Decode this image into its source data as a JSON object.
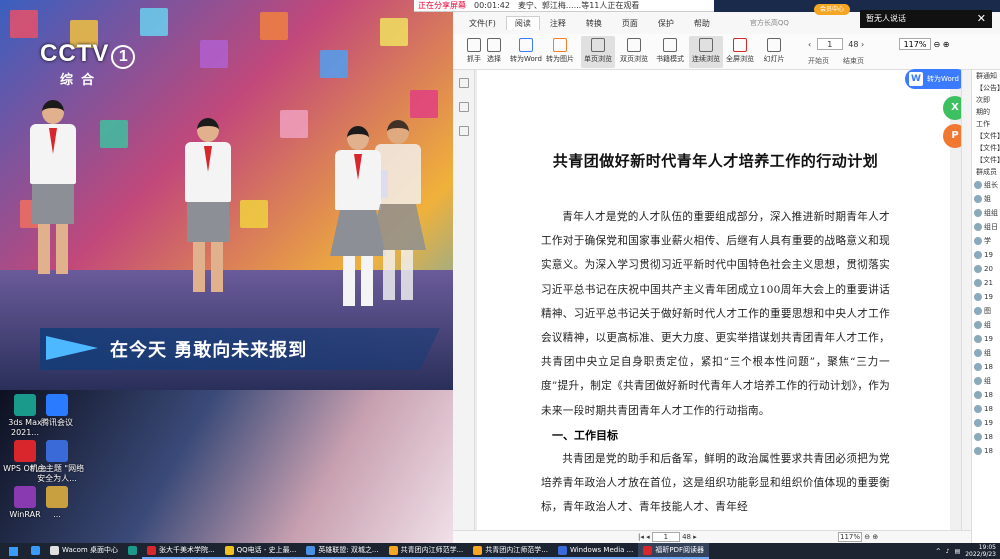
{
  "video": {
    "channel": "CCTV",
    "channel_num": "1",
    "channel_sub": "综合",
    "caption": "在今天 勇敢向未来报到"
  },
  "desktop_icons": [
    {
      "label": "3ds Max 2021...",
      "color": "#1a9a8a"
    },
    {
      "label": "腾讯会议",
      "color": "#2a7bff"
    },
    {
      "label": "WPS Office",
      "color": "#d8262c"
    },
    {
      "label": "机主主题 \"网络安全为人...",
      "color": "#3a6ad8"
    },
    {
      "label": "WinRAR",
      "color": "#8a3ab0"
    },
    {
      "label": "...",
      "color": "#c8a040"
    }
  ],
  "sharebar": {
    "status": "正在分享屏幕",
    "timer": "00:01:42",
    "viewers": "麦宁、郭江梅......等11人正在观看"
  },
  "app": {
    "menu": [
      "文件(F)",
      "阅读",
      "注释",
      "转换",
      "页面",
      "保护",
      "帮助"
    ],
    "menu_active": "阅读",
    "brand": "官方长高QQ",
    "member": "会员中心",
    "notice": "暂无人说话",
    "toolbar": [
      {
        "label": "抓手",
        "selected": false
      },
      {
        "label": "选择",
        "selected": false
      },
      {
        "label": "转为Word",
        "selected": false
      },
      {
        "label": "转为图片",
        "selected": false
      },
      {
        "label": "单页浏览",
        "selected": true
      },
      {
        "label": "双页浏览",
        "selected": false
      },
      {
        "label": "书籍模式",
        "selected": false
      },
      {
        "label": "连续浏览",
        "selected": true
      },
      {
        "label": "全屏浏览",
        "selected": false
      },
      {
        "label": "幻灯片",
        "selected": false
      }
    ],
    "page_current": "1",
    "page_total": "48",
    "zoom": "117%",
    "nav_start": "开始页",
    "nav_end": "结束页",
    "to_word_btn": "转为Word",
    "float_x": "X",
    "float_p": "P"
  },
  "document": {
    "title": "共青团做好新时代青年人才培养工作的行动计划",
    "paragraph1": "青年人才是党的人才队伍的重要组成部分，深入推进新时期青年人才工作对于确保党和国家事业薪火相传、后继有人具有重要的战略意义和现实意义。为深入学习贯彻习近平新时代中国特色社会主义思想，贯彻落实习近平总书记在庆祝中国共产主义青年团成立100周年大会上的重要讲话精神、习近平总书记关于做好新时代人才工作的重要思想和中央人才工作会议精神，以更高标准、更大力度、更实举措谋划共青团青年人才工作，共青团中央立足自身职责定位，紧扣“三个根本性问题”，聚焦“三力一度”提升，制定《共青团做好新时代青年人才培养工作的行动计划》，作为未来一段时期共青团青年人才工作的行动指南。",
    "heading1": "一、工作目标",
    "paragraph2": "共青团是党的助手和后备军，鲜明的政治属性要求共青团必须把为党培养青年政治人才放在首位，这是组织功能彰显和组织价值体现的重要衡标，青年政治人才、青年技能人才、青年经"
  },
  "statusbar": {
    "page_current": "1",
    "page_total": "48",
    "zoom": "117%"
  },
  "qq_panel": {
    "lines": [
      "群通知",
      "【公告】",
      "次即",
      "期的",
      "工作",
      "【文件】",
      "【文件】",
      "【文件】",
      "群成员"
    ],
    "members": [
      "组长",
      "姐",
      "组组",
      "组日",
      "学",
      "19",
      "20",
      "21",
      "19",
      "图",
      "组",
      "19",
      "组",
      "18",
      "组",
      "18",
      "18",
      "19",
      "18",
      "18"
    ]
  },
  "taskbar": {
    "apps": [
      {
        "label": "",
        "color": "#3a9bff",
        "state": ""
      },
      {
        "label": "Wacom 桌面中心",
        "color": "#e0e0e0",
        "state": ""
      },
      {
        "label": "",
        "color": "#1a9a8a",
        "state": ""
      },
      {
        "label": "张大千美术学院...",
        "color": "#d8262c",
        "state": "open"
      },
      {
        "label": "QQ电话 - 史上最...",
        "color": "#f0c020",
        "state": "open"
      },
      {
        "label": "英雄联盟: 双城之...",
        "color": "#4a90e2",
        "state": "open"
      },
      {
        "label": "共青团内江师范学...",
        "color": "#f5a623",
        "state": "open"
      },
      {
        "label": "共青团内江师范学...",
        "color": "#f5a623",
        "state": "open"
      },
      {
        "label": "Windows Media ...",
        "color": "#3a6ad8",
        "state": "open"
      },
      {
        "label": "福昕PDF阅读器",
        "color": "#d8262c",
        "state": "active"
      }
    ],
    "time": "19:05",
    "date": "2022/9/23"
  }
}
